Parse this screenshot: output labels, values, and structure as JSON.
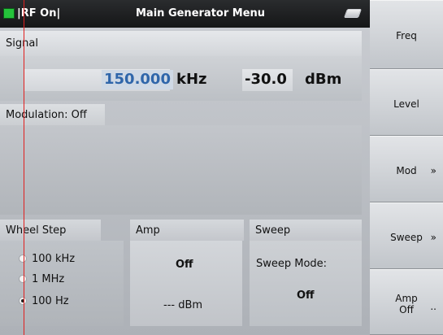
{
  "titlebar": {
    "rf_state": "|RF On|",
    "menu_title": "Main Generator Menu",
    "led_color": "#25c43b",
    "storage_icon": "card-icon"
  },
  "signal": {
    "header": "Signal",
    "frequency_value": "150.000",
    "frequency_unit": "kHz",
    "level_value": "-30.0",
    "level_unit": "dBm"
  },
  "modulation": {
    "header": "Modulation: Off"
  },
  "wheel_step": {
    "header": "Wheel Step",
    "options": [
      {
        "label": "100 kHz",
        "selected": false
      },
      {
        "label": "1 MHz",
        "selected": false
      },
      {
        "label": "100 Hz",
        "selected": true
      }
    ]
  },
  "amp": {
    "header": "Amp",
    "state": "Off",
    "level": "--- dBm"
  },
  "sweep": {
    "header": "Sweep",
    "mode_label": "Sweep Mode:",
    "mode_value": "Off"
  },
  "softkeys": {
    "freq": "Freq",
    "level": "Level",
    "mod": "Mod",
    "mod_arrow": "»",
    "sweep": "Sweep",
    "sweep_arrow": "»",
    "amp_line1": "Amp",
    "amp_line2": "Off",
    "amp_arrow": ".."
  },
  "colors": {
    "accent_value_bg": "#cfd9e5",
    "accent_value_text": "#2f66aa",
    "cursor_line": "#e02020"
  }
}
